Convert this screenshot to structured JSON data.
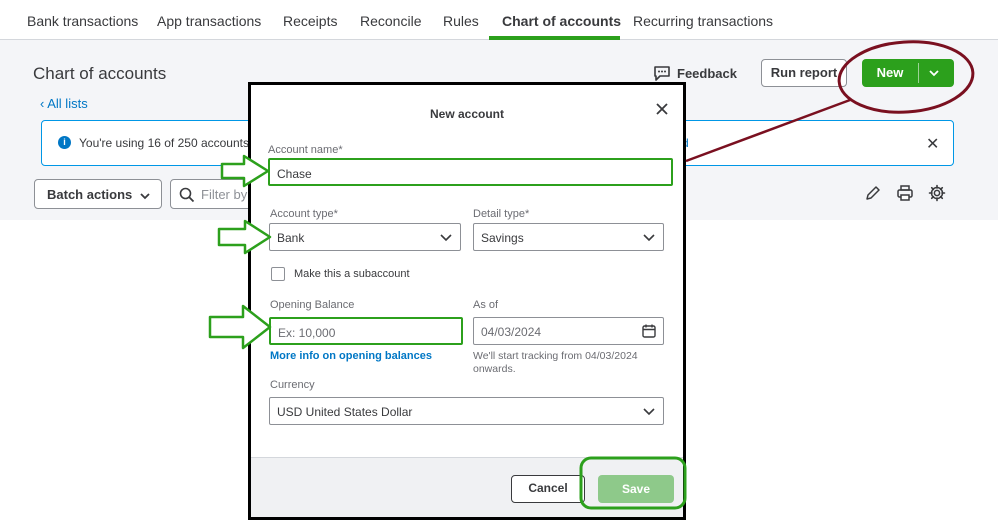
{
  "tabs": [
    {
      "label": "Bank transactions",
      "active": false
    },
    {
      "label": "App transactions",
      "active": false
    },
    {
      "label": "Receipts",
      "active": false
    },
    {
      "label": "Reconcile",
      "active": false
    },
    {
      "label": "Rules",
      "active": false
    },
    {
      "label": "Chart of accounts",
      "active": true
    },
    {
      "label": "Recurring transactions",
      "active": false
    }
  ],
  "page": {
    "title": "Chart of accounts",
    "all_lists": "All lists",
    "feedback": "Feedback",
    "run_report": "Run report",
    "new_button": "New",
    "banner_text": "You're using 16 of 250 accounts",
    "banner_link_fragment": "d",
    "batch_actions": "Batch actions",
    "filter_placeholder": "Filter by"
  },
  "modal": {
    "title": "New account",
    "account_name_label": "Account name*",
    "account_name_value": "Chase",
    "account_type_label": "Account type*",
    "account_type_value": "Bank",
    "detail_type_label": "Detail type*",
    "detail_type_value": "Savings",
    "subaccount_label": "Make this a subaccount",
    "opening_balance_label": "Opening Balance",
    "opening_balance_placeholder": "Ex: 10,000",
    "as_of_label": "As of",
    "as_of_value": "04/03/2024",
    "more_info_link": "More info on opening balances",
    "tracking_helper": "We'll start tracking from 04/03/2024 onwards.",
    "currency_label": "Currency",
    "currency_value": "USD United States Dollar",
    "cancel": "Cancel",
    "save": "Save"
  },
  "colors": {
    "brand_green": "#2ca01c",
    "link_blue": "#0077c5",
    "annotation_maroon": "#7a1020",
    "annotation_green": "#2ca01c"
  }
}
